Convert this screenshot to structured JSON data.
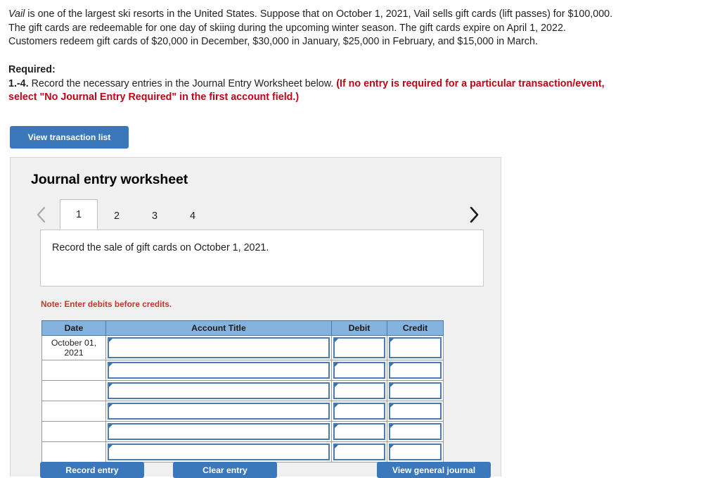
{
  "problem": {
    "company": "Vail",
    "sentence1_rest": " is one of the largest ski resorts in the United States. Suppose that on October 1, 2021, Vail sells gift cards (lift passes) for $100,000.",
    "sentence2": "The gift cards are redeemable for one day of skiing during the upcoming winter season. The gift cards expire on April 1, 2022.",
    "sentence3": "Customers redeem gift cards of $20,000 in December, $30,000 in January, $25,000 in February, and $15,000 in March."
  },
  "required": {
    "heading": "Required:",
    "item_number": "1.-4.",
    "item_text": " Record the necessary entries in the Journal Entry Worksheet below. ",
    "red_line1": "(If no entry is required for a particular transaction/event,",
    "red_line2": "select \"No Journal Entry Required\" in the first account field.)"
  },
  "toolbar": {
    "view_transaction_list_label": "View transaction list"
  },
  "worksheet": {
    "title": "Journal entry worksheet",
    "tabs": [
      {
        "label": "1",
        "active": true
      },
      {
        "label": "2",
        "active": false
      },
      {
        "label": "3",
        "active": false
      },
      {
        "label": "4",
        "active": false
      }
    ],
    "prev_icon": "chevron-left-icon",
    "next_icon": "chevron-right-icon",
    "transaction_description": "Record the sale of gift cards on October 1, 2021.",
    "note": "Note: Enter debits before credits.",
    "table": {
      "columns": [
        "Date",
        "Account Title",
        "Debit",
        "Credit"
      ],
      "rows": [
        {
          "date": "October 01, 2021",
          "account_title": "",
          "debit": "",
          "credit": ""
        },
        {
          "date": "",
          "account_title": "",
          "debit": "",
          "credit": ""
        },
        {
          "date": "",
          "account_title": "",
          "debit": "",
          "credit": ""
        },
        {
          "date": "",
          "account_title": "",
          "debit": "",
          "credit": ""
        },
        {
          "date": "",
          "account_title": "",
          "debit": "",
          "credit": ""
        },
        {
          "date": "",
          "account_title": "",
          "debit": "",
          "credit": ""
        }
      ]
    },
    "buttons": {
      "record_entry": "Record entry",
      "clear_entry": "Clear entry",
      "view_general_journal": "View general journal"
    }
  },
  "colors": {
    "button_blue": "#3b77bb",
    "header_blue": "#85b3e0",
    "field_border_blue": "#4a7cb0",
    "alert_red": "#c00418",
    "note_red": "#c0392b",
    "panel_gray": "#f0f0f0"
  }
}
